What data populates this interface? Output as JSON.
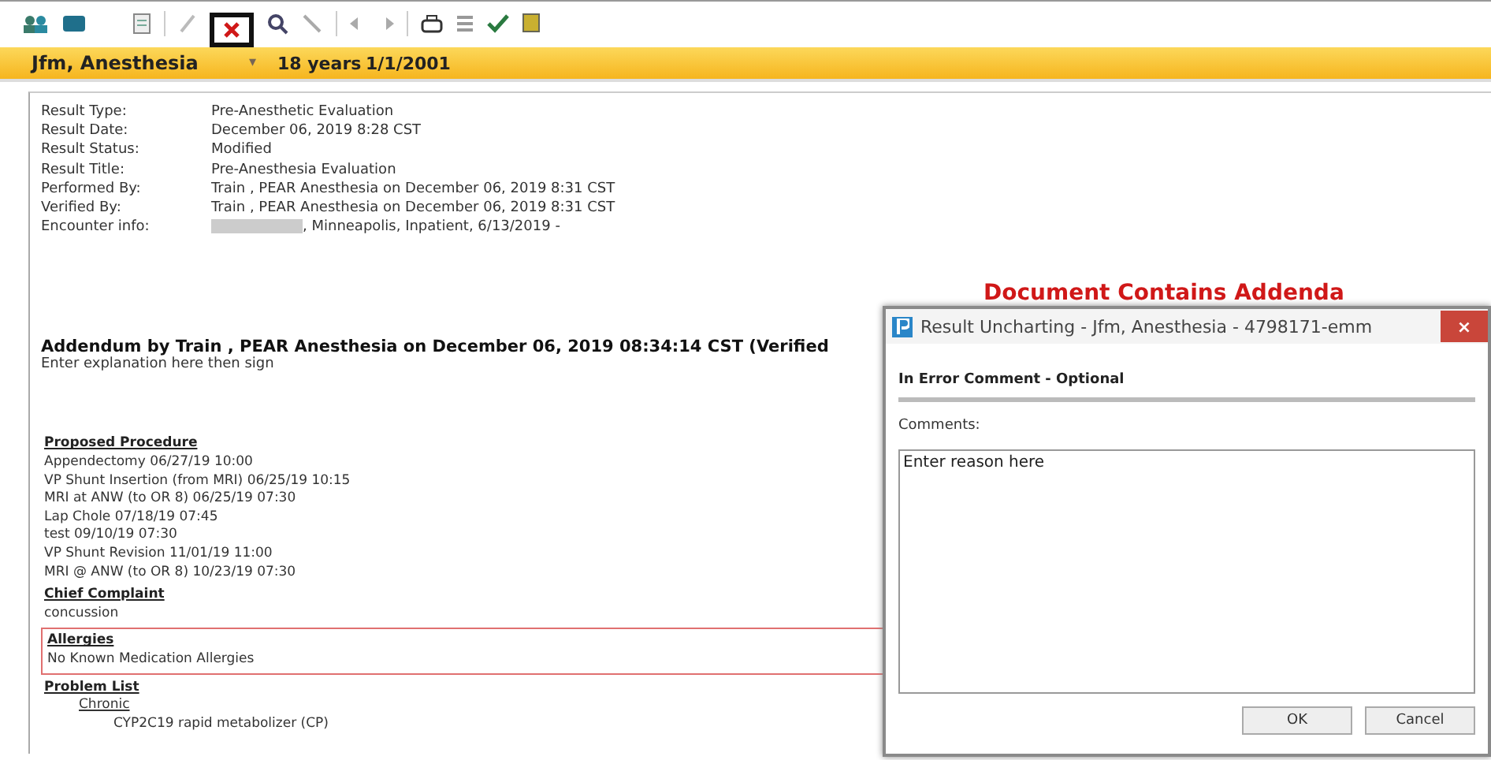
{
  "patient_banner": {
    "name": "Jfm, Anesthesia",
    "dropdown": "▾",
    "age": "18 years",
    "dob": "1/1/2001"
  },
  "result_fields": [
    {
      "label": "Result Type:",
      "value": "Pre-Anesthetic Evaluation",
      "redacted": false
    },
    {
      "label": "Result Date:",
      "value": "December 06, 2019 8:28 CST",
      "redacted": false
    },
    {
      "label": "Result Status:",
      "value": "Modified",
      "redacted": false
    },
    {
      "label": "Result Title:",
      "value": "Pre-Anesthesia Evaluation",
      "redacted": false
    },
    {
      "label": "Performed By:",
      "value": "Train , PEAR Anesthesia on December 06, 2019 8:31 CST",
      "redacted": false
    },
    {
      "label": "Verified By:",
      "value": "Train , PEAR Anesthesia on December 06, 2019 8:31 CST",
      "redacted": false
    },
    {
      "label": "Encounter info:",
      "value": ", Minneapolis, Inpatient, 6/13/2019 -",
      "redacted": true
    }
  ],
  "addenda_notice": "Document Contains Addenda",
  "addendum": {
    "title": "Addendum by Train , PEAR Anesthesia on December 06, 2019 08:34:14 CST (Verified",
    "text": "Enter explanation here then sign"
  },
  "sections": [
    {
      "heading": "Proposed Procedure",
      "highlighted": false,
      "lines": [
        {
          "text": "Appendectomy 06/27/19 10:00"
        },
        {
          "text": "VP Shunt Insertion (from MRI) 06/25/19 10:15"
        },
        {
          "text": "MRI at ANW (to OR 8) 06/25/19 07:30"
        },
        {
          "text": "Lap Chole 07/18/19 07:45"
        },
        {
          "text": "test 09/10/19 07:30"
        },
        {
          "text": "VP Shunt Revision 11/01/19 11:00"
        },
        {
          "text": "MRI @ ANW (to OR 8) 10/23/19 07:30"
        }
      ]
    },
    {
      "heading": "Chief Complaint",
      "highlighted": false,
      "lines": [
        {
          "text": "concussion"
        }
      ]
    },
    {
      "heading": "Allergies",
      "highlighted": true,
      "lines": [
        {
          "text": "No Known Medication Allergies"
        }
      ]
    },
    {
      "heading": "Problem List",
      "highlighted": false,
      "lines": [
        {
          "text": "Chronic",
          "kind": "subheading",
          "children": [
            {
              "text": "CYP2C19 rapid metabolizer (CP)"
            }
          ]
        }
      ]
    }
  ],
  "dialog": {
    "close": "×",
    "title": "Result Uncharting - Jfm, Anesthesia - 4798171-emm",
    "section_title": "In Error Comment - Optional",
    "comments_label": "Comments:",
    "comments_value": "Enter reason here",
    "buttons": [
      "OK",
      "Cancel"
    ]
  }
}
